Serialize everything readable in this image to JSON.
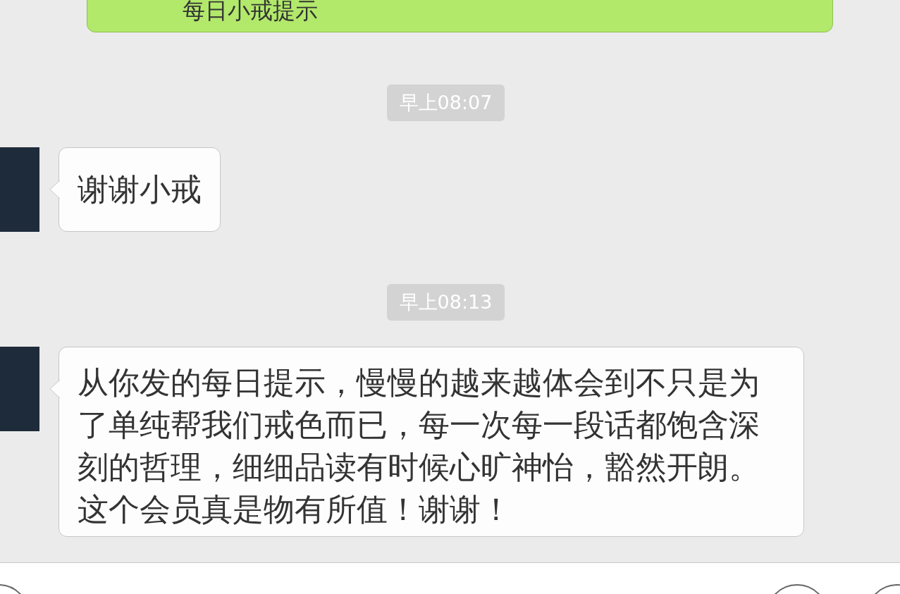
{
  "messages": [
    {
      "kind": "outgoing",
      "text": "每日小戒提示"
    },
    {
      "kind": "time",
      "text": "早上08:07"
    },
    {
      "kind": "incoming",
      "text": "谢谢小戒"
    },
    {
      "kind": "time",
      "text": "早上08:13"
    },
    {
      "kind": "incoming",
      "text": "从你发的每日提示，慢慢的越来越体会到不只是为了单纯帮我们戒色而已，每一次每一段话都饱含深刻的哲理，细细品读有时候心旷神怡，豁然开朗。这个会员真是物有所值！谢谢！"
    }
  ]
}
